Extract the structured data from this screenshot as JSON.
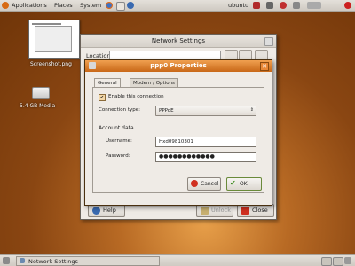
{
  "top_panel": {
    "menus": [
      "Applications",
      "Places",
      "System"
    ],
    "user": "ubuntu",
    "brand_color": "#e07a1f"
  },
  "desktop": {
    "screenshot_label": "Screenshot.png",
    "drive_label": "5.4 GB Media"
  },
  "network_window": {
    "title": "Network Settings",
    "location_label": "Location:",
    "location_value": "",
    "buttons": {
      "help": "Help",
      "unlock": "Unlock",
      "close": "Close"
    }
  },
  "ppp_dialog": {
    "title": "ppp0 Properties",
    "tabs": [
      "General",
      "Modem / Options"
    ],
    "enable_label": "Enable this connection",
    "enable_checked": true,
    "connection_type_label": "Connection type:",
    "connection_type_value": "PPPoE",
    "account_heading": "Account data",
    "username_label": "Username:",
    "username_value": "Hxd09810301",
    "password_label": "Password:",
    "password_value": "●●●●●●●●●●●●",
    "cancel_label": "Cancel",
    "ok_label": "OK"
  },
  "bottom_panel": {
    "task_label": "Network Settings"
  }
}
